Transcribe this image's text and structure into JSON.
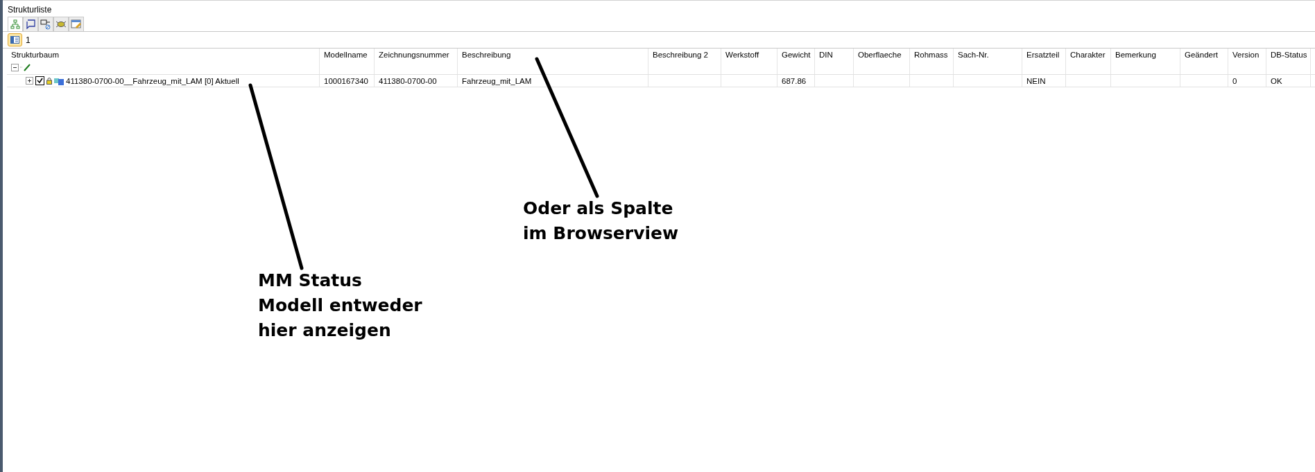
{
  "window": {
    "title": "Strukturliste"
  },
  "toolbar": {
    "tabs": [
      {
        "kind": "tree",
        "selected": true
      },
      {
        "kind": "frame",
        "selected": false
      },
      {
        "kind": "label",
        "selected": false
      },
      {
        "kind": "bug",
        "selected": false
      },
      {
        "kind": "table",
        "selected": false
      }
    ]
  },
  "view_bar": {
    "selected": true,
    "label": "1"
  },
  "table": {
    "columns": [
      "Strukturbaum",
      "Modellname",
      "Zeichnungsnummer",
      "Beschreibung",
      "Beschreibung 2",
      "Werkstoff",
      "Gewicht",
      "DIN",
      "Oberflaeche",
      "Rohmass",
      "Sach-Nr.",
      "Ersatzteil",
      "Charakter",
      "Bemerkung",
      "Geändert",
      "Version",
      "DB-Status"
    ],
    "root": {
      "expanded": true
    },
    "rows": [
      {
        "expanded": false,
        "checked": true,
        "locked": true,
        "cells": [
          "411380-0700-00__Fahrzeug_mit_LAM [0] Aktuell",
          "1000167340",
          "411380-0700-00",
          "Fahrzeug_mit_LAM",
          "",
          "",
          "687.86",
          "",
          "",
          "",
          "",
          "NEIN",
          "",
          "",
          "",
          "0",
          "OK"
        ]
      }
    ]
  },
  "annotations": [
    {
      "lines": [
        "Oder als Spalte",
        "im Browserview"
      ]
    },
    {
      "lines": [
        "MM Status",
        "Modell entweder",
        "hier anzeigen"
      ]
    }
  ]
}
